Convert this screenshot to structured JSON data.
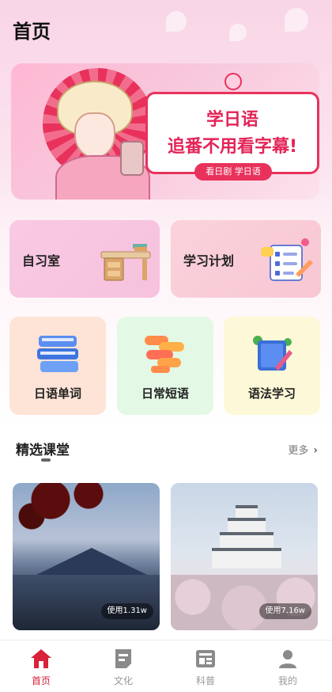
{
  "header": {
    "title": "首页"
  },
  "banner": {
    "line1": "学日语",
    "line2": "追番不用看字幕!",
    "tag": "看日剧 学日语"
  },
  "features_big": [
    {
      "label": "自习室",
      "icon": "desk-icon"
    },
    {
      "label": "学习计划",
      "icon": "checklist-icon"
    }
  ],
  "features_small": [
    {
      "label": "日语单词",
      "icon": "books-icon"
    },
    {
      "label": "日常短语",
      "icon": "chat-bubbles-icon"
    },
    {
      "label": "语法学习",
      "icon": "notebook-pen-icon"
    }
  ],
  "section": {
    "title": "精选课堂",
    "more": "更多"
  },
  "courses": [
    {
      "usage": "使用1.31w"
    },
    {
      "usage": "使用7.16w"
    }
  ],
  "nav": {
    "items": [
      {
        "label": "首页",
        "icon": "home-icon",
        "active": true
      },
      {
        "label": "文化",
        "icon": "document-icon",
        "active": false
      },
      {
        "label": "科普",
        "icon": "article-icon",
        "active": false
      },
      {
        "label": "我的",
        "icon": "user-icon",
        "active": false
      }
    ]
  },
  "colors": {
    "accent": "#d8213a",
    "banner_red": "#e8325c"
  }
}
